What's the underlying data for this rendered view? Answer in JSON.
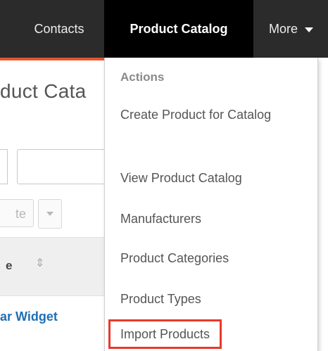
{
  "nav": {
    "contacts": "Contacts",
    "product_catalog": "Product Catalog",
    "more": "More"
  },
  "page": {
    "title": "duct Cata",
    "bulk_action": "te",
    "column_header": "e",
    "row_link": "ar Widget"
  },
  "menu": {
    "heading": "Actions",
    "items": [
      "Create Product for Catalog",
      "View Product Catalog",
      "Manufacturers",
      "Product Categories",
      "Product Types",
      "Import Products"
    ]
  },
  "icons": {
    "more_caret": "chevron-down-icon",
    "sort": "sort-icon",
    "bulk_caret": "chevron-down-icon"
  },
  "colors": {
    "nav_bg": "#2b2b2b",
    "active_tab_bg": "#000000",
    "accent": "#e4572e",
    "highlight_outline": "#e8392a",
    "link": "#1f6fb5"
  }
}
